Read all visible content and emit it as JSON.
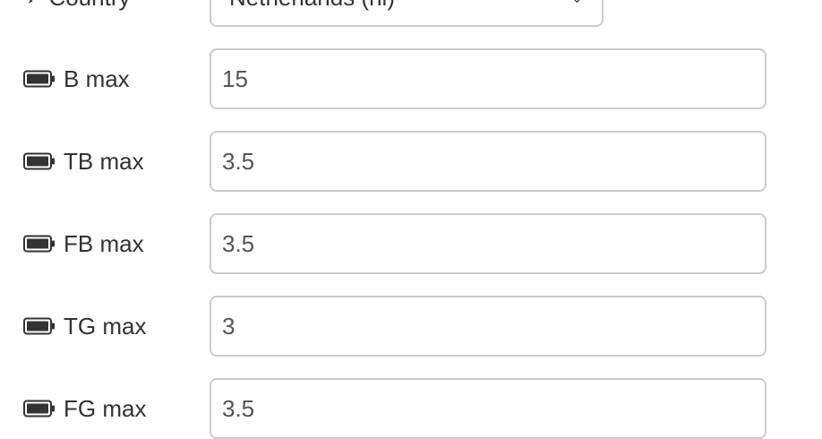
{
  "country": {
    "label": "Country",
    "value": "Netherlands (nl)",
    "icon": "map-pin-icon"
  },
  "fields": [
    {
      "label": "B max",
      "value": "15",
      "icon": "battery-icon"
    },
    {
      "label": "TB max",
      "value": "3.5",
      "icon": "battery-icon"
    },
    {
      "label": "FB max",
      "value": "3.5",
      "icon": "battery-icon"
    },
    {
      "label": "TG max",
      "value": "3",
      "icon": "battery-icon"
    },
    {
      "label": "FG max",
      "value": "3.5",
      "icon": "battery-icon"
    }
  ]
}
